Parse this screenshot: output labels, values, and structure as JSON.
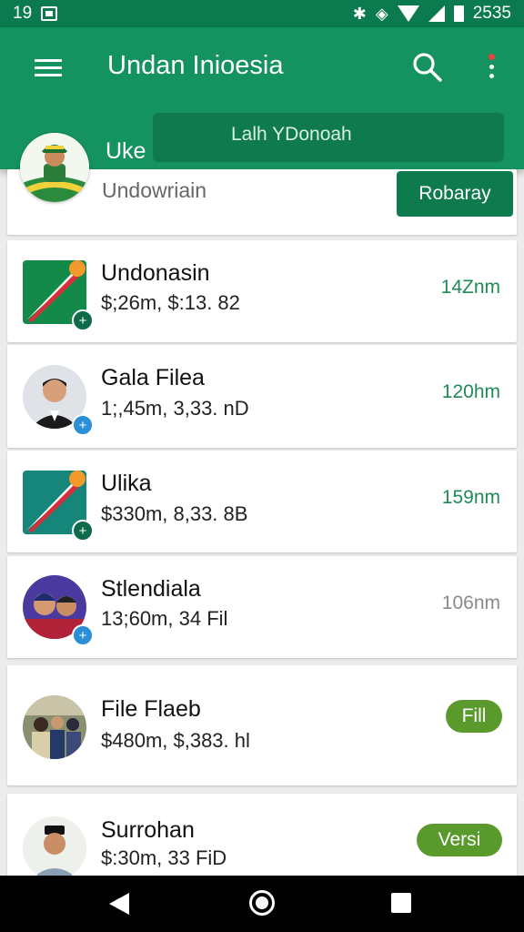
{
  "status_bar": {
    "time": "19",
    "clock": "2535",
    "icons": [
      "image-icon",
      "bluetooth-icon",
      "data-saver-icon",
      "wifi-icon",
      "signal-icon",
      "battery-icon"
    ]
  },
  "app_bar": {
    "title": "Undan Inioesia",
    "profile_name": "Uke Iherai",
    "search_text": "Lalh YDonoah",
    "colors": {
      "primary": "#14925f",
      "dark": "#0f7a4d",
      "notify": "#e4463b"
    }
  },
  "header": {
    "subtitle": "Undowriain",
    "button_label": "Robaray"
  },
  "items": [
    {
      "title": "Undonasin",
      "subtitle": "$;26m, $:13. 82",
      "time": "14Znm",
      "avatar": "flag-icon"
    },
    {
      "title": "Gala Filea",
      "subtitle": "1;,45m, 3,33. nD",
      "time": "120hm",
      "avatar": "person-avatar"
    },
    {
      "title": "Ulika",
      "subtitle": "$330m, 8,33. 8B",
      "time": "159nm",
      "avatar": "flag-icon"
    },
    {
      "title": "Stlendiala",
      "subtitle": "13;60m, 34  Fil",
      "time": "106nm",
      "avatar": "group-avatar"
    },
    {
      "title": "File Flaeb",
      "subtitle": "$480m, $,383. hl",
      "pill": "Fill",
      "pill_color": "#5a9a2d",
      "avatar": "crowd-avatar"
    },
    {
      "title": "Surrohan",
      "subtitle": "$:30m, 33  FiD",
      "pill": "Versi",
      "pill_color": "#5a9a2d",
      "avatar": "person-avatar"
    }
  ]
}
